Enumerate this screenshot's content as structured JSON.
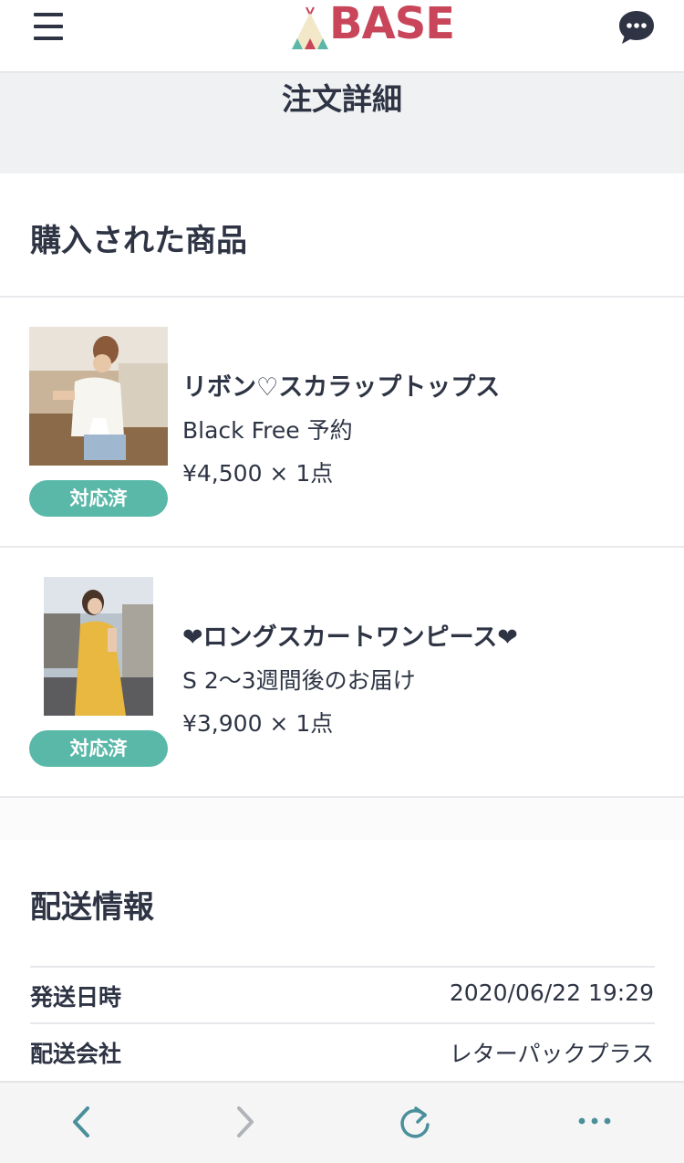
{
  "header": {
    "logo_text": "BASE",
    "menu_icon": "hamburger-menu-icon",
    "chat_icon": "chat-bubble-icon"
  },
  "page": {
    "title": "注文詳細"
  },
  "purchased": {
    "heading": "購入された商品",
    "items": [
      {
        "name": "リボン♡スカラップトップス",
        "variant": "Black Free 予約",
        "price": "¥4,500 × 1点",
        "status": "対応済"
      },
      {
        "name": "❤ロングスカートワンピース❤",
        "variant": "S 2〜3週間後のお届け",
        "price": "¥3,900 × 1点",
        "status": "対応済"
      }
    ]
  },
  "shipping": {
    "heading": "配送情報",
    "rows": [
      {
        "label": "発送日時",
        "value": "2020/06/22 19:29"
      },
      {
        "label": "配送会社",
        "value": "レターパックプラス"
      }
    ]
  },
  "browser_bar": {
    "icons": [
      "back-arrow-icon",
      "forward-arrow-icon",
      "reload-icon",
      "more-dots-icon"
    ]
  },
  "colors": {
    "text": "#2e3444",
    "badge": "#5ab8a8",
    "title_band": "#f0f1f3",
    "logo_red": "#c8455a",
    "browser_icon": "#4a8f9a"
  }
}
